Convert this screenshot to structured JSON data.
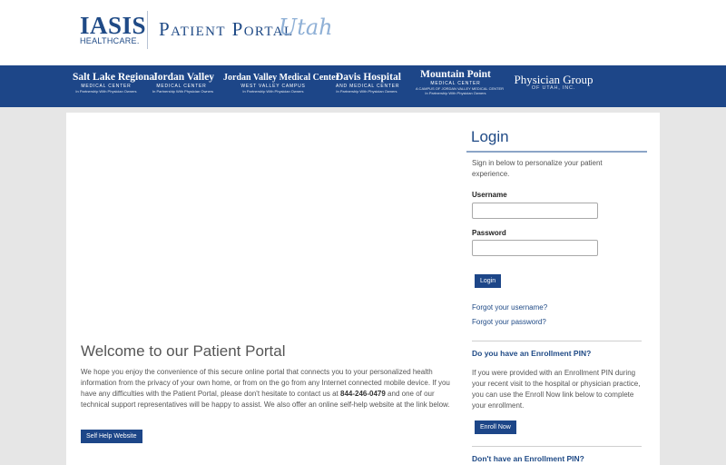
{
  "header": {
    "brand": {
      "main": "IASIS",
      "sub": "HEALTHCARE."
    },
    "portal_title": "Patient Portal",
    "portal_state": "Utah"
  },
  "hospitals": [
    {
      "name": "Salt Lake Regional",
      "sub": "MEDICAL CENTER",
      "tag": "In Partnership With Physician Owners"
    },
    {
      "name": "Jordan Valley",
      "sub": "MEDICAL CENTER",
      "tag": "In Partnership With Physician Owners"
    },
    {
      "name": "Jordan Valley Medical Center",
      "sub": "WEST VALLEY CAMPUS",
      "tag": "In Partnership With Physician Owners"
    },
    {
      "name": "Davis Hospital",
      "sub": "AND MEDICAL CENTER",
      "tag": "In Partnership With Physician Owners"
    },
    {
      "name": "Mountain Point",
      "sub": "MEDICAL CENTER",
      "tag": "A CAMPUS OF JORDAN VALLEY MEDICAL CENTER",
      "tag2": "In Partnership With Physician Owners"
    },
    {
      "name": "Physician Group",
      "sub": "OF UTAH, INC.",
      "tag": ""
    }
  ],
  "welcome": {
    "title": "Welcome to our Patient Portal",
    "body_part1": "We hope you enjoy the convenience of this secure online portal that connects you to your personalized health information from the privacy of your own home, or from on the go from any Internet connected mobile device. If you have any difficulties with the Patient Portal, please don't hesitate to contact us at ",
    "phone": "844-246-0479",
    "body_part2": " and one of our technical support representatives will be happy to assist. We also offer an online self-help website at the link below.",
    "help_button": "Self Help Website"
  },
  "login": {
    "title": "Login",
    "intro": "Sign in below to personalize your patient experience.",
    "username_label": "Username",
    "username_value": "",
    "password_label": "Password",
    "password_value": "",
    "button": "Login",
    "forgot_username": "Forgot your username?",
    "forgot_password": "Forgot your password?"
  },
  "enrollment": {
    "heading": "Do you have an Enrollment PIN?",
    "body": "If you were provided with an Enrollment PIN during your recent visit to the hospital or physician practice, you can use the Enroll Now link below to complete your enrollment.",
    "button": "Enroll Now",
    "no_pin_heading": "Don't have an Enrollment PIN?"
  }
}
